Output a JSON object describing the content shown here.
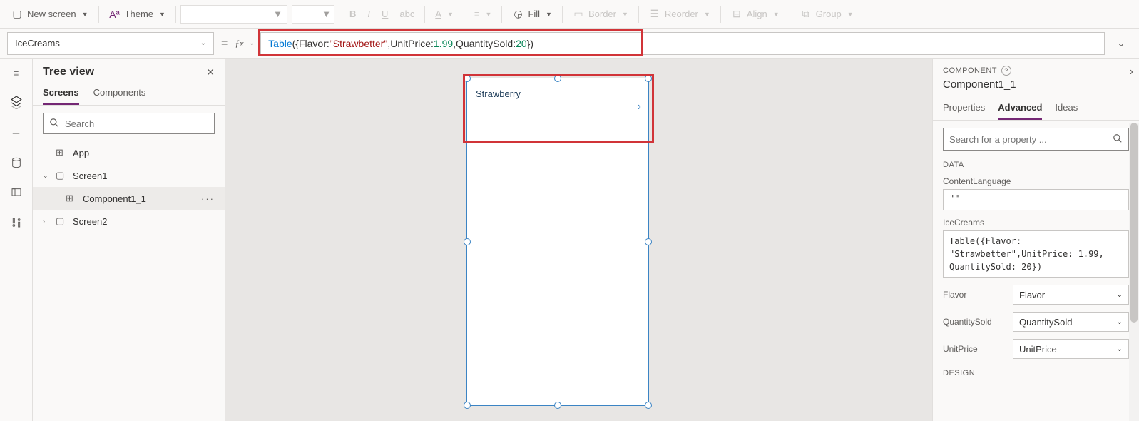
{
  "toolbar": {
    "new_screen": "New screen",
    "theme": "Theme",
    "fill": "Fill",
    "border": "Border",
    "reorder": "Reorder",
    "align": "Align",
    "group": "Group"
  },
  "formula_bar": {
    "property": "IceCreams",
    "tokens": {
      "table": "Table",
      "open": "({",
      "k1": "Flavor",
      "colon": ": ",
      "v1": "\"Strawbetter\"",
      "comma": ",",
      "k2": "UnitPrice",
      "v2": "1.99",
      "comma2": ", ",
      "k3": "QuantitySold",
      "v3": "20",
      "close": "})"
    }
  },
  "tree": {
    "title": "Tree view",
    "tabs": {
      "screens": "Screens",
      "components": "Components"
    },
    "search_placeholder": "Search",
    "app": "App",
    "screen1": "Screen1",
    "component": "Component1_1",
    "screen2": "Screen2",
    "more": "···"
  },
  "canvas": {
    "list_item_text": "Strawberry"
  },
  "right": {
    "component_label": "COMPONENT",
    "name": "Component1_1",
    "tabs": {
      "properties": "Properties",
      "advanced": "Advanced",
      "ideas": "Ideas"
    },
    "search_placeholder": "Search for a property ...",
    "sections": {
      "data": "DATA",
      "design": "DESIGN"
    },
    "content_language": {
      "label": "ContentLanguage",
      "value": "\"\""
    },
    "icecreams": {
      "label": "IceCreams",
      "value": "Table({Flavor: \"Strawbetter\",UnitPrice: 1.99, QuantitySold: 20})"
    },
    "fields": {
      "flavor": {
        "label": "Flavor",
        "value": "Flavor"
      },
      "qty": {
        "label": "QuantitySold",
        "value": "QuantitySold"
      },
      "price": {
        "label": "UnitPrice",
        "value": "UnitPrice"
      }
    }
  }
}
